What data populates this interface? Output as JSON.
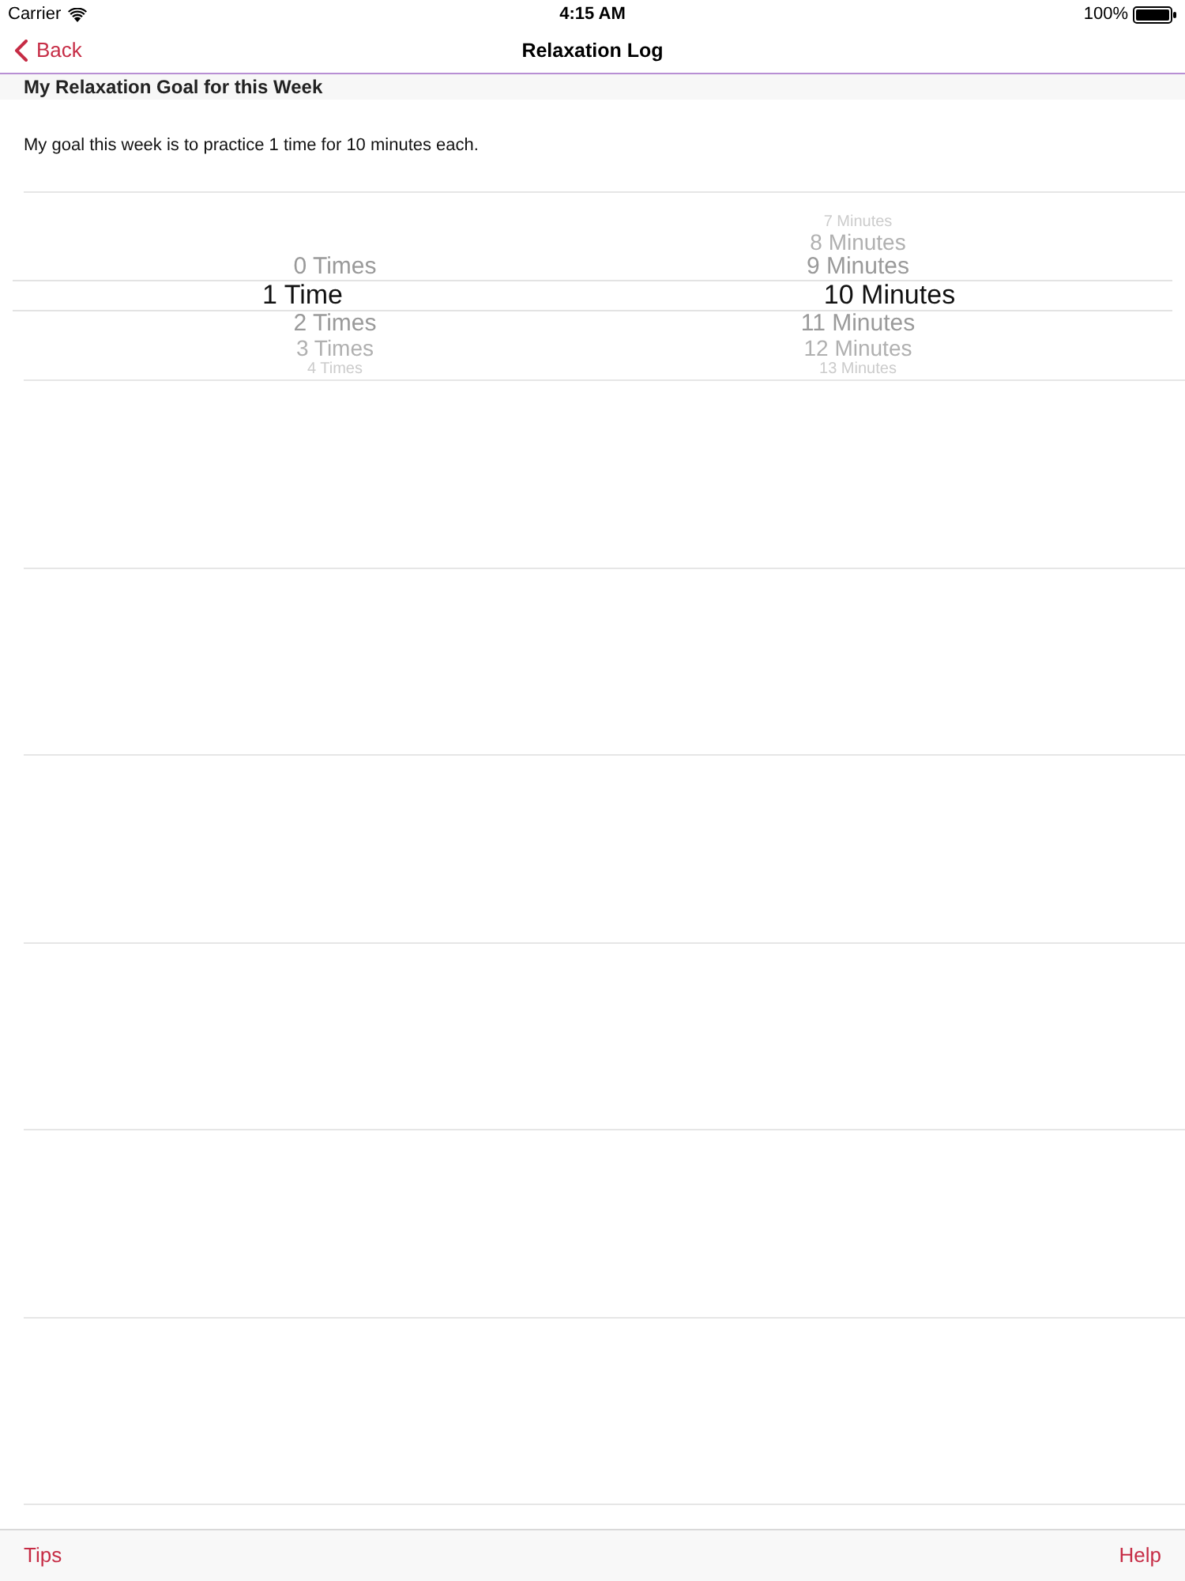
{
  "status_bar": {
    "carrier": "Carrier",
    "time": "4:15 AM",
    "battery": "100%"
  },
  "nav_bar": {
    "back": "Back",
    "title": "Relaxation Log"
  },
  "section_header": "My Relaxation Goal for this Week",
  "goal_text": "My goal this week is to practice 1 time for 10 minutes each.",
  "picker": {
    "columns": [
      {
        "items": [
          {
            "label": "0 Times",
            "selected": false
          },
          {
            "label": "1 Time",
            "selected": true
          },
          {
            "label": "2 Times",
            "selected": false
          },
          {
            "label": "3 Times",
            "selected": false
          },
          {
            "label": "4 Times",
            "selected": false
          }
        ]
      },
      {
        "items": [
          {
            "label": "7 Minutes",
            "selected": false
          },
          {
            "label": "8 Minutes",
            "selected": false
          },
          {
            "label": "9 Minutes",
            "selected": false
          },
          {
            "label": "10 Minutes",
            "selected": true
          },
          {
            "label": "11 Minutes",
            "selected": false
          },
          {
            "label": "12 Minutes",
            "selected": false
          },
          {
            "label": "13 Minutes",
            "selected": false
          }
        ]
      }
    ]
  },
  "toolbar": {
    "left": "Tips",
    "right": "Help"
  }
}
